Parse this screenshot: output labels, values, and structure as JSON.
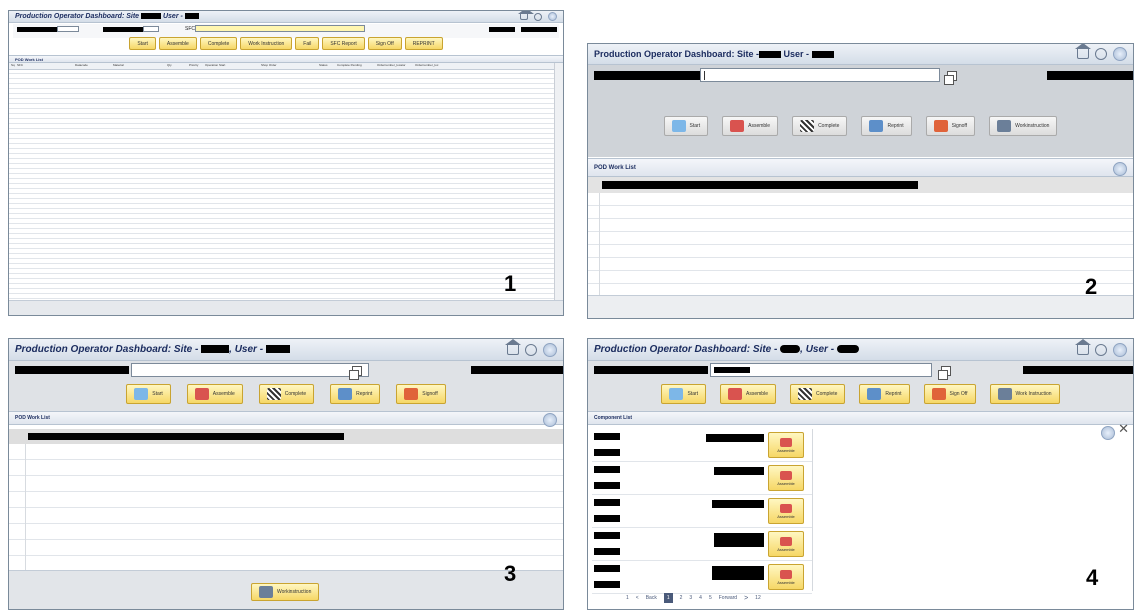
{
  "panels": [
    {
      "number": "1",
      "title": "Production Operator Dashboard: Site",
      "user_label": "User -",
      "sfc_label": "SFC",
      "buttons": [
        "Start",
        "Assemble",
        "Complete",
        "Work Instruction",
        "Fail",
        "SFC Report",
        "Sign Off",
        "REPRINT"
      ],
      "worklist_title": "POD Work List",
      "columns": [
        "Sq",
        "SFC",
        "Datacode",
        "Material",
        "Qty",
        "Priority",
        "Operation Start",
        "Shop Order",
        "Status",
        "Complete Pending",
        "Ordernumber_locator",
        "Ordernumber_loc"
      ]
    },
    {
      "number": "2",
      "title": "Production Operator Dashboard: Site -",
      "user_label": "User -",
      "buttons": [
        "Start",
        "Assemble",
        "Complete",
        "Reprint",
        "Signoff",
        "Workinstruction"
      ],
      "worklist_title": "POD Work List"
    },
    {
      "number": "3",
      "title": "Production Operator Dashboard: Site -",
      "user_label": ", User -",
      "buttons": [
        "Start",
        "Assemble",
        "Complete",
        "Reprint",
        "Signoff"
      ],
      "worklist_title": "POD Work List",
      "bottom_button": "Workinstruction"
    },
    {
      "number": "4",
      "title": "Production Operator Dashboard: Site -",
      "user_label": ", User -",
      "buttons": [
        "Start",
        "Assemble",
        "Complete",
        "Reprint",
        "Sign Off",
        "Work Instruction"
      ],
      "component_list_title": "Component List",
      "assemble_label": "Assemble",
      "pagination": [
        "1",
        "<",
        "Back",
        "1",
        "2",
        "3",
        "4",
        "5",
        "Forward",
        ">",
        "12"
      ]
    }
  ],
  "colors": {
    "title_text": "#1a2b5e",
    "button_fill": "#f6d766",
    "redaction": "#000000",
    "toolbar_grey": "#cfd3d8"
  }
}
